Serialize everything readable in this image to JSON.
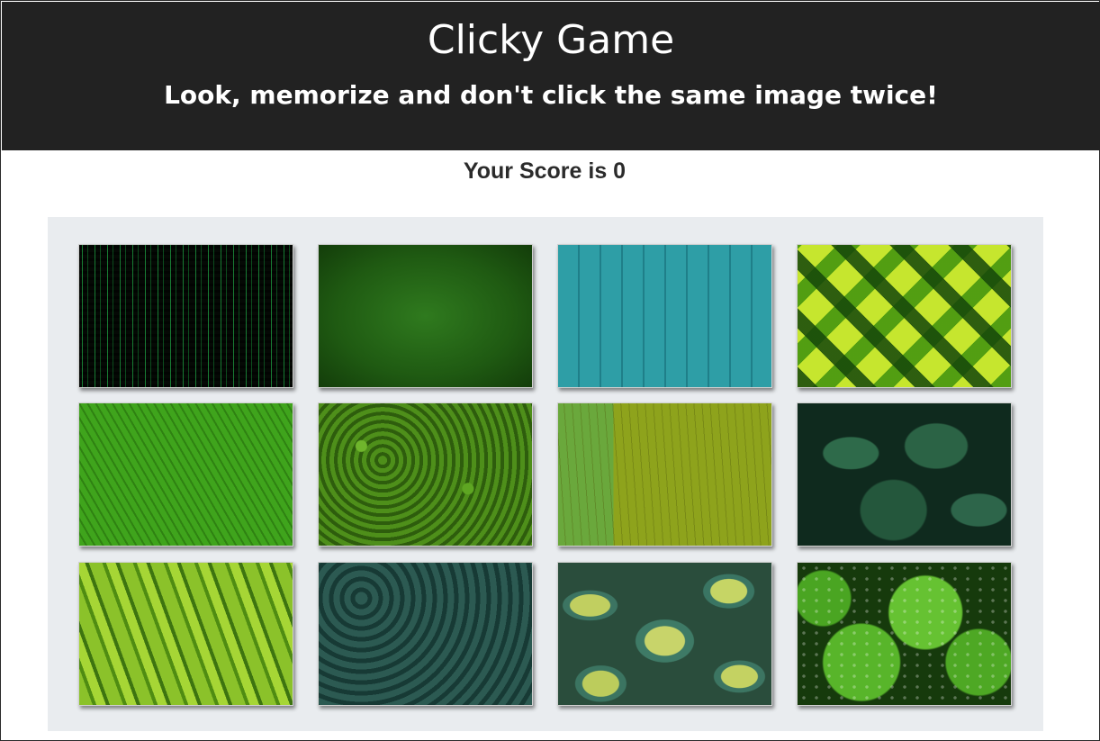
{
  "header": {
    "title": "Clicky Game",
    "subtitle": "Look, memorize and don't click the same image twice!"
  },
  "score": {
    "text": "Your Score is 0",
    "value": 0
  },
  "board": {
    "tiles": [
      {
        "name": "image-tile-matrix-code",
        "image": "green-matrix-code"
      },
      {
        "name": "image-tile-grass",
        "image": "green-grass"
      },
      {
        "name": "image-tile-teal-wood",
        "image": "teal-wood-planks"
      },
      {
        "name": "image-tile-lattice-leaves",
        "image": "woven-leaves-lattice"
      },
      {
        "name": "image-tile-palm-leaf",
        "image": "palm-leaf"
      },
      {
        "name": "image-tile-shrub",
        "image": "leafy-shrub"
      },
      {
        "name": "image-tile-field",
        "image": "aerial-field"
      },
      {
        "name": "image-tile-monstera",
        "image": "monstera-leaves"
      },
      {
        "name": "image-tile-hosta",
        "image": "hosta-leaves"
      },
      {
        "name": "image-tile-succulents",
        "image": "dark-succulents"
      },
      {
        "name": "image-tile-variegated-hosta",
        "image": "variegated-hosta"
      },
      {
        "name": "image-tile-droplets",
        "image": "water-droplet-leaves"
      }
    ]
  },
  "colors": {
    "header_bg": "#222222",
    "header_text": "#ffffff",
    "board_bg": "#e9ecef",
    "score_text": "#2b2b2b"
  }
}
